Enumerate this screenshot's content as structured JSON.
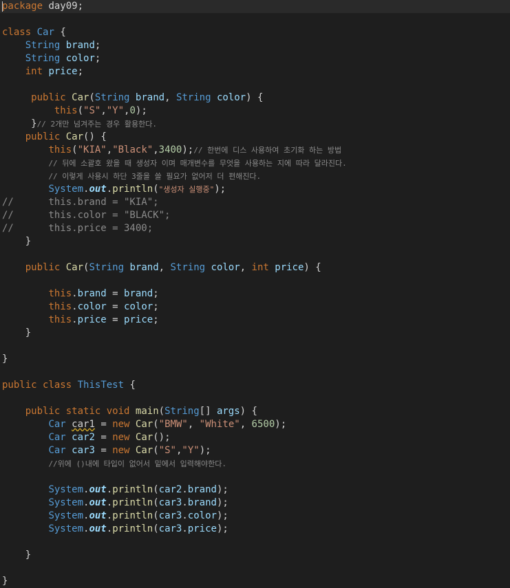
{
  "colors": {
    "background": "#1e1e1e",
    "current_line": "#2a2a2a",
    "keyword": "#cc7832",
    "type": "#569cd6",
    "identifier": "#9cdcfe",
    "method": "#dcdcaa",
    "string": "#ce9178",
    "number": "#b5cea8",
    "comment": "#8c8c8c"
  },
  "lines": [
    [
      [
        "kw",
        "package"
      ],
      [
        "txt",
        " day09;"
      ]
    ],
    [],
    [
      [
        "kw",
        "class"
      ],
      [
        "txt",
        " "
      ],
      [
        "ty",
        "Car"
      ],
      [
        "txt",
        " {"
      ]
    ],
    [
      [
        "txt",
        "    "
      ],
      [
        "ty",
        "String"
      ],
      [
        "txt",
        " "
      ],
      [
        "id",
        "brand"
      ],
      [
        "txt",
        ";"
      ]
    ],
    [
      [
        "txt",
        "    "
      ],
      [
        "ty",
        "String"
      ],
      [
        "txt",
        " "
      ],
      [
        "id",
        "color"
      ],
      [
        "txt",
        ";"
      ]
    ],
    [
      [
        "txt",
        "    "
      ],
      [
        "kw",
        "int"
      ],
      [
        "txt",
        " "
      ],
      [
        "id",
        "price"
      ],
      [
        "txt",
        ";"
      ]
    ],
    [],
    [
      [
        "txt",
        "     "
      ],
      [
        "kw",
        "public"
      ],
      [
        "txt",
        " "
      ],
      [
        "fn",
        "Car"
      ],
      [
        "txt",
        "("
      ],
      [
        "ty",
        "String"
      ],
      [
        "txt",
        " "
      ],
      [
        "id",
        "brand"
      ],
      [
        "txt",
        ", "
      ],
      [
        "ty",
        "String"
      ],
      [
        "txt",
        " "
      ],
      [
        "id",
        "color"
      ],
      [
        "txt",
        ") {"
      ]
    ],
    [
      [
        "txt",
        "         "
      ],
      [
        "kw",
        "this"
      ],
      [
        "txt",
        "("
      ],
      [
        "st",
        "\"S\""
      ],
      [
        "txt",
        ","
      ],
      [
        "st",
        "\"Y\""
      ],
      [
        "txt",
        ","
      ],
      [
        "nu",
        "0"
      ],
      [
        "txt",
        ");"
      ]
    ],
    [
      [
        "txt",
        "     }"
      ],
      [
        "cm",
        "// 2개만 넘겨주는 경우 활용한다."
      ]
    ],
    [
      [
        "txt",
        "    "
      ],
      [
        "kw",
        "public"
      ],
      [
        "txt",
        " "
      ],
      [
        "fn",
        "Car"
      ],
      [
        "txt",
        "() {"
      ]
    ],
    [
      [
        "txt",
        "        "
      ],
      [
        "kw",
        "this"
      ],
      [
        "txt",
        "("
      ],
      [
        "st",
        "\"KIA\""
      ],
      [
        "txt",
        ","
      ],
      [
        "st",
        "\"Black\""
      ],
      [
        "txt",
        ","
      ],
      [
        "nu",
        "3400"
      ],
      [
        "txt",
        ");"
      ],
      [
        "cm",
        "// 한번에 디스 사용하여 초기화 하는 방법"
      ]
    ],
    [
      [
        "txt",
        "        "
      ],
      [
        "cm",
        "// 뒤에 소괄호 왔을 때 생성자 이며 매개변수를 무엇을 사용하는 지에 따라 달라진다."
      ]
    ],
    [
      [
        "txt",
        "        "
      ],
      [
        "cm",
        "// 이렇게 사용시 하단 3줄을 쓸 필요가 없어저 더 편해진다."
      ]
    ],
    [
      [
        "txt",
        "        "
      ],
      [
        "ty",
        "System"
      ],
      [
        "txt",
        "."
      ],
      [
        "static",
        "out"
      ],
      [
        "txt",
        "."
      ],
      [
        "fn",
        "println"
      ],
      [
        "txt",
        "("
      ],
      [
        "st",
        "\"생성자 실행중\""
      ],
      [
        "txt",
        ");"
      ]
    ],
    [
      [
        "cm",
        "//      this.brand = \"KIA\";"
      ]
    ],
    [
      [
        "cm",
        "//      this.color = \"BLACK\";"
      ]
    ],
    [
      [
        "cm",
        "//      this.price = 3400;"
      ]
    ],
    [
      [
        "txt",
        "    }"
      ]
    ],
    [],
    [
      [
        "txt",
        "    "
      ],
      [
        "kw",
        "public"
      ],
      [
        "txt",
        " "
      ],
      [
        "fn",
        "Car"
      ],
      [
        "txt",
        "("
      ],
      [
        "ty",
        "String"
      ],
      [
        "txt",
        " "
      ],
      [
        "id",
        "brand"
      ],
      [
        "txt",
        ", "
      ],
      [
        "ty",
        "String"
      ],
      [
        "txt",
        " "
      ],
      [
        "id",
        "color"
      ],
      [
        "txt",
        ", "
      ],
      [
        "kw",
        "int"
      ],
      [
        "txt",
        " "
      ],
      [
        "id",
        "price"
      ],
      [
        "txt",
        ") {"
      ]
    ],
    [],
    [
      [
        "txt",
        "        "
      ],
      [
        "kw",
        "this"
      ],
      [
        "txt",
        "."
      ],
      [
        "id",
        "brand"
      ],
      [
        "txt",
        " = "
      ],
      [
        "id",
        "brand"
      ],
      [
        "txt",
        ";"
      ]
    ],
    [
      [
        "txt",
        "        "
      ],
      [
        "kw",
        "this"
      ],
      [
        "txt",
        "."
      ],
      [
        "id",
        "color"
      ],
      [
        "txt",
        " = "
      ],
      [
        "id",
        "color"
      ],
      [
        "txt",
        ";"
      ]
    ],
    [
      [
        "txt",
        "        "
      ],
      [
        "kw",
        "this"
      ],
      [
        "txt",
        "."
      ],
      [
        "id",
        "price"
      ],
      [
        "txt",
        " = "
      ],
      [
        "id",
        "price"
      ],
      [
        "txt",
        ";"
      ]
    ],
    [
      [
        "txt",
        "    }"
      ]
    ],
    [],
    [
      [
        "txt",
        "}"
      ]
    ],
    [],
    [
      [
        "kw",
        "public"
      ],
      [
        "txt",
        " "
      ],
      [
        "kw",
        "class"
      ],
      [
        "txt",
        " "
      ],
      [
        "ty",
        "ThisTest"
      ],
      [
        "txt",
        " {"
      ]
    ],
    [],
    [
      [
        "txt",
        "    "
      ],
      [
        "kw",
        "public"
      ],
      [
        "txt",
        " "
      ],
      [
        "kw",
        "static"
      ],
      [
        "txt",
        " "
      ],
      [
        "kw",
        "void"
      ],
      [
        "txt",
        " "
      ],
      [
        "fn",
        "main"
      ],
      [
        "txt",
        "("
      ],
      [
        "ty",
        "String"
      ],
      [
        "txt",
        "[] "
      ],
      [
        "id",
        "args"
      ],
      [
        "txt",
        ") {"
      ]
    ],
    [
      [
        "txt",
        "        "
      ],
      [
        "ty",
        "Car"
      ],
      [
        "txt",
        " "
      ],
      [
        "warn",
        "car1"
      ],
      [
        "txt",
        " = "
      ],
      [
        "kw",
        "new"
      ],
      [
        "txt",
        " "
      ],
      [
        "fn",
        "Car"
      ],
      [
        "txt",
        "("
      ],
      [
        "st",
        "\"BMW\""
      ],
      [
        "txt",
        ", "
      ],
      [
        "st",
        "\"White\""
      ],
      [
        "txt",
        ", "
      ],
      [
        "nu",
        "6500"
      ],
      [
        "txt",
        ");"
      ]
    ],
    [
      [
        "txt",
        "        "
      ],
      [
        "ty",
        "Car"
      ],
      [
        "txt",
        " "
      ],
      [
        "id",
        "car2"
      ],
      [
        "txt",
        " = "
      ],
      [
        "kw",
        "new"
      ],
      [
        "txt",
        " "
      ],
      [
        "fn",
        "Car"
      ],
      [
        "txt",
        "();"
      ]
    ],
    [
      [
        "txt",
        "        "
      ],
      [
        "ty",
        "Car"
      ],
      [
        "txt",
        " "
      ],
      [
        "id",
        "car3"
      ],
      [
        "txt",
        " = "
      ],
      [
        "kw",
        "new"
      ],
      [
        "txt",
        " "
      ],
      [
        "fn",
        "Car"
      ],
      [
        "txt",
        "("
      ],
      [
        "st",
        "\"S\""
      ],
      [
        "txt",
        ","
      ],
      [
        "st",
        "\"Y\""
      ],
      [
        "txt",
        ");"
      ]
    ],
    [
      [
        "txt",
        "        "
      ],
      [
        "cm",
        "//위에 ()내에 타입이 없어서 밑에서 입력해야한다."
      ]
    ],
    [],
    [
      [
        "txt",
        "        "
      ],
      [
        "ty",
        "System"
      ],
      [
        "txt",
        "."
      ],
      [
        "static",
        "out"
      ],
      [
        "txt",
        "."
      ],
      [
        "fn",
        "println"
      ],
      [
        "txt",
        "("
      ],
      [
        "id",
        "car2"
      ],
      [
        "txt",
        "."
      ],
      [
        "id",
        "brand"
      ],
      [
        "txt",
        ");"
      ]
    ],
    [
      [
        "txt",
        "        "
      ],
      [
        "ty",
        "System"
      ],
      [
        "txt",
        "."
      ],
      [
        "static",
        "out"
      ],
      [
        "txt",
        "."
      ],
      [
        "fn",
        "println"
      ],
      [
        "txt",
        "("
      ],
      [
        "id",
        "car3"
      ],
      [
        "txt",
        "."
      ],
      [
        "id",
        "brand"
      ],
      [
        "txt",
        ");"
      ]
    ],
    [
      [
        "txt",
        "        "
      ],
      [
        "ty",
        "System"
      ],
      [
        "txt",
        "."
      ],
      [
        "static",
        "out"
      ],
      [
        "txt",
        "."
      ],
      [
        "fn",
        "println"
      ],
      [
        "txt",
        "("
      ],
      [
        "id",
        "car3"
      ],
      [
        "txt",
        "."
      ],
      [
        "id",
        "color"
      ],
      [
        "txt",
        ");"
      ]
    ],
    [
      [
        "txt",
        "        "
      ],
      [
        "ty",
        "System"
      ],
      [
        "txt",
        "."
      ],
      [
        "static",
        "out"
      ],
      [
        "txt",
        "."
      ],
      [
        "fn",
        "println"
      ],
      [
        "txt",
        "("
      ],
      [
        "id",
        "car3"
      ],
      [
        "txt",
        "."
      ],
      [
        "id",
        "price"
      ],
      [
        "txt",
        ");"
      ]
    ],
    [],
    [
      [
        "txt",
        "    }"
      ]
    ],
    [],
    [
      [
        "txt",
        "}"
      ]
    ]
  ]
}
